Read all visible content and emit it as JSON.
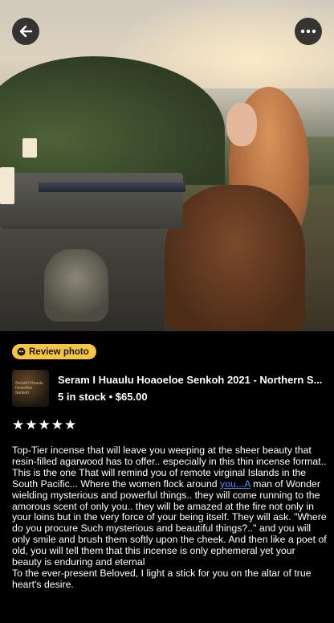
{
  "review_badge": {
    "label": "Review photo"
  },
  "product": {
    "thumb_text": "Seram I Huaulu Hoaoeloe Senkoh",
    "title": "Seram I Huaulu Hoaoeloe Senkoh 2021 - Northern S...",
    "stock": "5 in stock",
    "separator": "•",
    "price": "$65.00"
  },
  "rating": {
    "stars": 5,
    "max": 5
  },
  "review": {
    "p1": "Top-Tier incense that will leave you weeping at the sheer beauty that resin-filled agarwood has to offer.. especially in this thin incense format..",
    "p2_before": "This is the one That will remind you of remote virginal Islands in the South Pacific... Where the women flock around ",
    "p2_link": "you...A",
    "p2_after": " man of Wonder wielding mysterious and powerful things.. they will come running to the amorous scent of only you.. they will be amazed at the fire not only in your loins but in the very force of your being itself. They will ask. \"Where do you procure Such mysterious and beautiful things?..\" and you will only smile and brush them softly upon the cheek. And then like a poet of old, you will tell them that this incense is only ephemeral yet your beauty is enduring and eternal",
    "p3": "To the ever-present Beloved, I light a stick for you on the altar of true heart's desire."
  },
  "colors": {
    "badge": "#f5c543",
    "link": "#4a8ff7",
    "background": "#000000"
  },
  "icons": {
    "back": "arrow-left-icon",
    "more": "more-horizontal-icon",
    "badge": "review-icon"
  }
}
